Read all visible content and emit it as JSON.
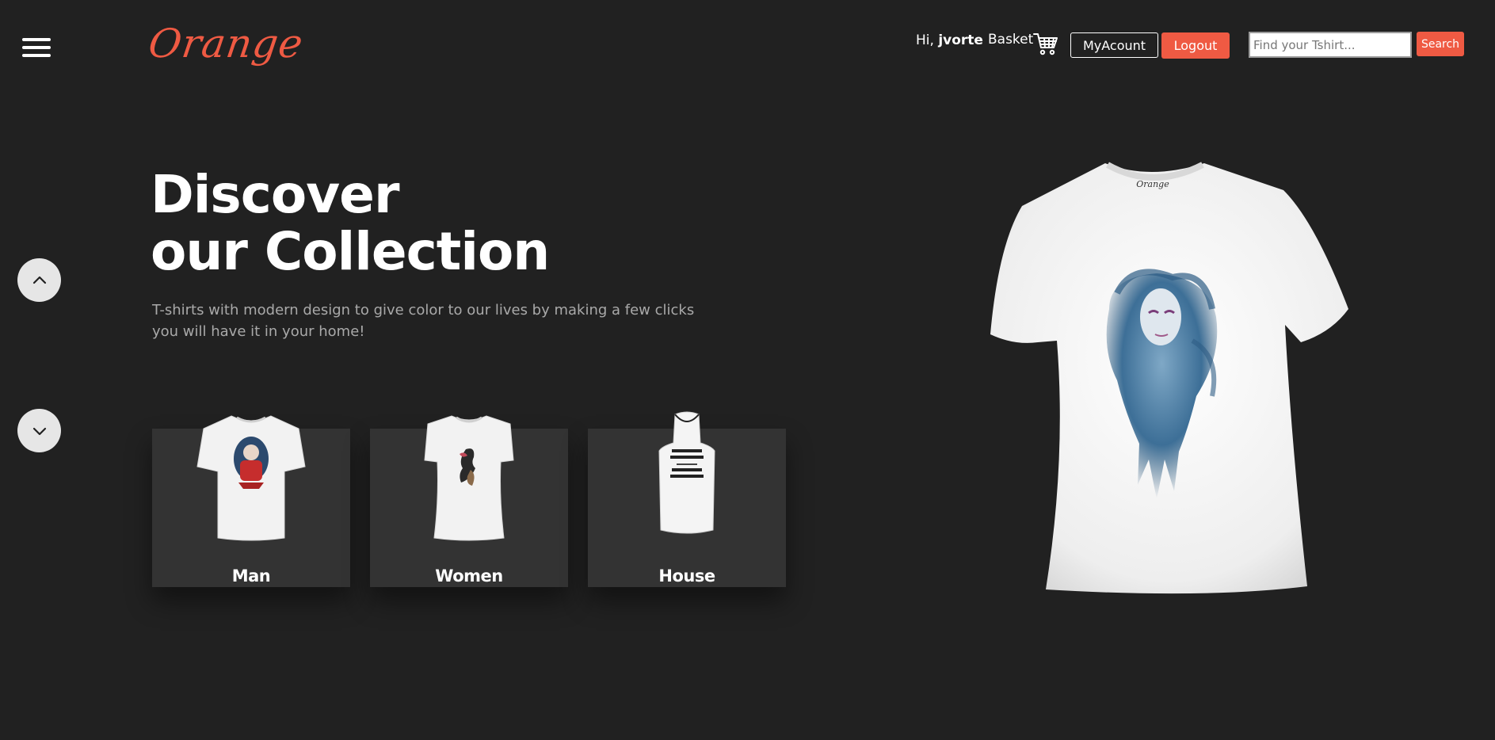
{
  "header": {
    "logo_text": "Orange",
    "greeting_prefix": "Hi,",
    "username": "jvorte",
    "basket_label": "Basket",
    "my_account_label": "MyAcount",
    "logout_label": "Logout",
    "search_placeholder": "Find your Tshirt...",
    "search_button_label": "Search"
  },
  "hero": {
    "title_line1": "Discover",
    "title_line2": "our Collection",
    "subtitle": "T-shirts with modern design to give color to our lives by making a few clicks you will have it in your home!"
  },
  "categories": [
    {
      "label": "Man",
      "icon": "man-tshirt-image"
    },
    {
      "label": "Women",
      "icon": "women-tshirt-image"
    },
    {
      "label": "House",
      "icon": "apron-image"
    }
  ],
  "colors": {
    "background": "#212121",
    "accent": "#ef5a43",
    "card": "#333333"
  },
  "icons": {
    "menu": "hamburger-menu-icon",
    "cart": "cart-icon",
    "scroll_up": "chevron-up-icon",
    "scroll_down": "chevron-down-icon"
  }
}
